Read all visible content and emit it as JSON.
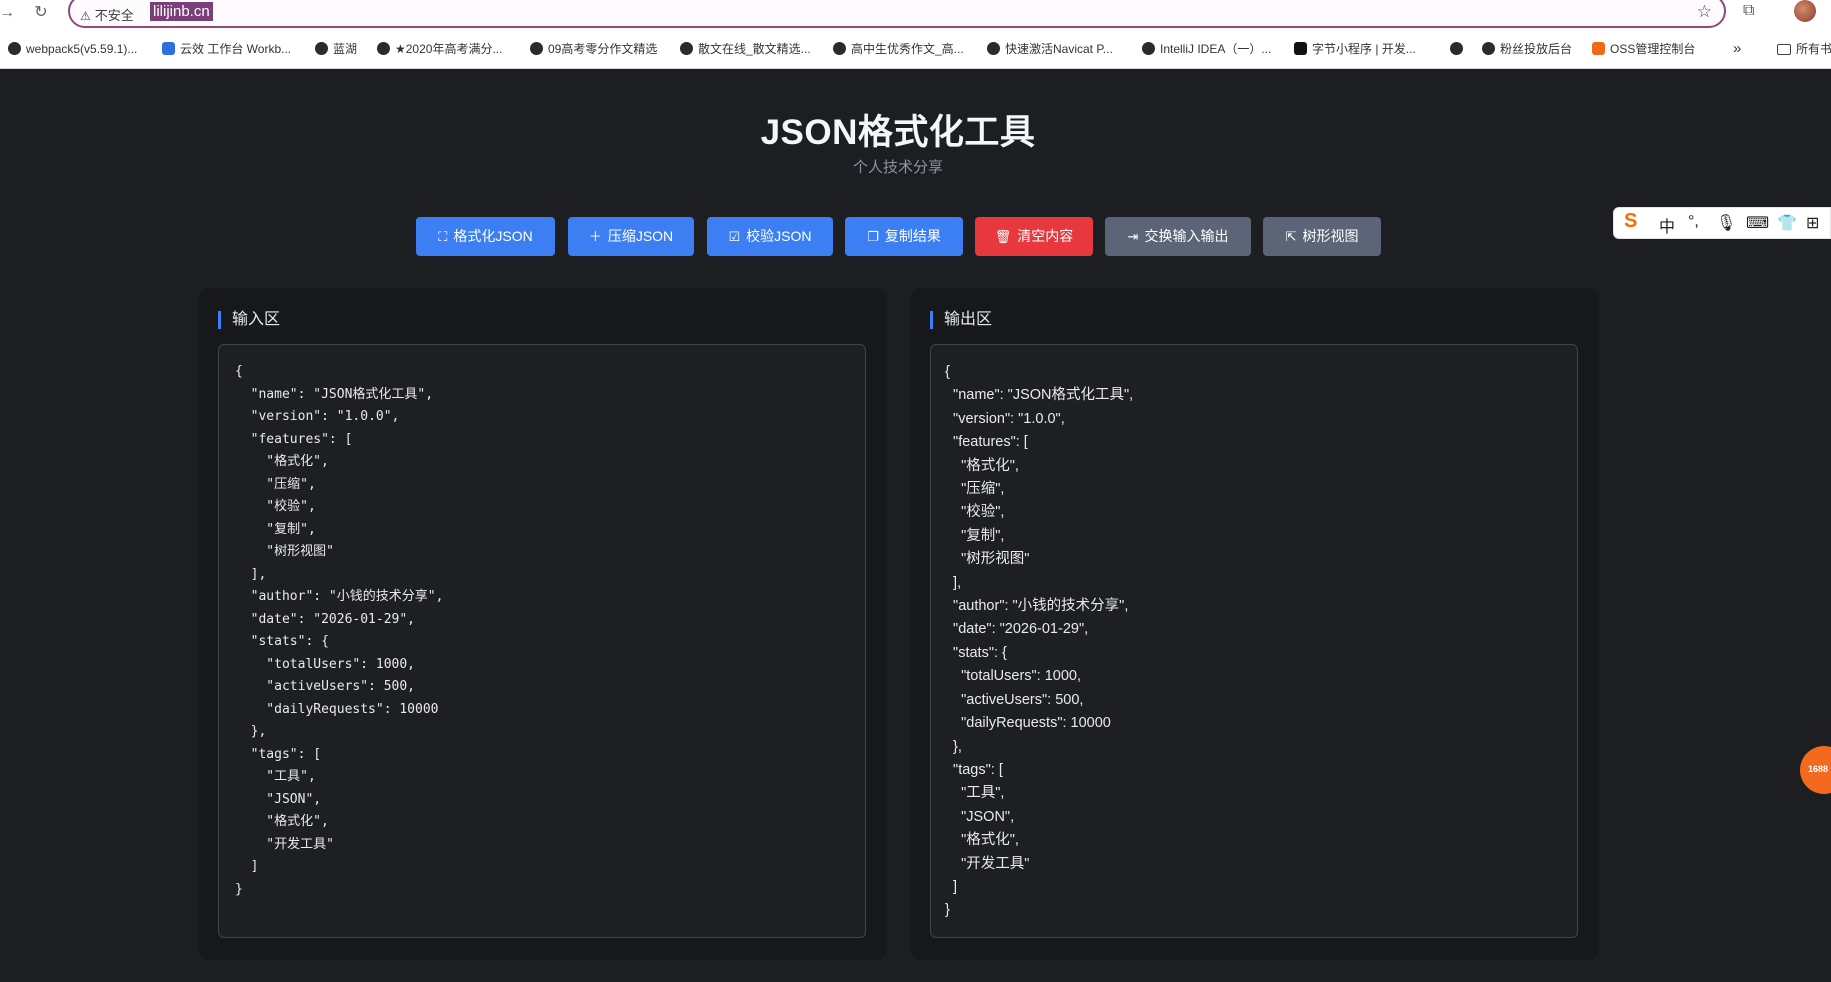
{
  "browser": {
    "security_label": "不安全",
    "url": "lilijinb.cn",
    "bookmarks": [
      "webpack5(v5.59.1)...",
      "云效 工作台 Workb...",
      "蓝湖",
      "★2020年高考满分...",
      "09高考零分作文精选",
      "散文在线_散文精选...",
      "高中生优秀作文_高...",
      "快速激活Navicat P...",
      "IntelliJ IDEA（一）...",
      "字节小程序 | 开发...",
      "",
      "粉丝投放后台",
      "OSS管理控制台",
      "»",
      "所有书签"
    ]
  },
  "app": {
    "title": "JSON格式化工具",
    "subtitle": "个人技术分享"
  },
  "toolbar": {
    "buttons": [
      {
        "label": "格式化JSON",
        "icon": "format-icon",
        "color": "#3b7ff2"
      },
      {
        "label": "压缩JSON",
        "icon": "plus-icon",
        "color": "#3b7ff2"
      },
      {
        "label": "校验JSON",
        "icon": "check-square-icon",
        "color": "#3b7ff2"
      },
      {
        "label": "复制结果",
        "icon": "copy-icon",
        "color": "#3b7ff2"
      },
      {
        "label": "清空内容",
        "icon": "trash-icon",
        "color": "#e7383d"
      },
      {
        "label": "交换输入输出",
        "icon": "swap-icon",
        "color": "#5b6577"
      },
      {
        "label": "树形视图",
        "icon": "external-link-icon",
        "color": "#5b6577"
      }
    ]
  },
  "input_panel": {
    "title": "输入区",
    "content": "{\n  \"name\": \"JSON格式化工具\",\n  \"version\": \"1.0.0\",\n  \"features\": [\n    \"格式化\",\n    \"压缩\",\n    \"校验\",\n    \"复制\",\n    \"树形视图\"\n  ],\n  \"author\": \"小钱的技术分享\",\n  \"date\": \"2026-01-29\",\n  \"stats\": {\n    \"totalUsers\": 1000,\n    \"activeUsers\": 500,\n    \"dailyRequests\": 10000\n  },\n  \"tags\": [\n    \"工具\",\n    \"JSON\",\n    \"格式化\",\n    \"开发工具\"\n  ]\n}"
  },
  "output_panel": {
    "title": "输出区",
    "content": "{\n  \"name\": \"JSON格式化工具\",\n  \"version\": \"1.0.0\",\n  \"features\": [\n    \"格式化\",\n    \"压缩\",\n    \"校验\",\n    \"复制\",\n    \"树形视图\"\n  ],\n  \"author\": \"小钱的技术分享\",\n  \"date\": \"2026-01-29\",\n  \"stats\": {\n    \"totalUsers\": 1000,\n    \"activeUsers\": 500,\n    \"dailyRequests\": 10000\n  },\n  \"tags\": [\n    \"工具\",\n    \"JSON\",\n    \"格式化\",\n    \"开发工具\"\n  ]\n}"
  },
  "ime_toolbar": {
    "mode": "中",
    "float_badge": "1688"
  },
  "colors": {
    "background": "#1d1e22",
    "panel": "#17181b",
    "accent": "#3b7ff2",
    "danger": "#e7383d",
    "secondary": "#5b6577"
  }
}
